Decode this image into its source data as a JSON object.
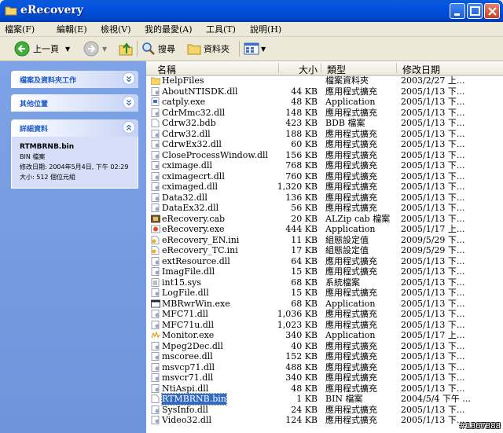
{
  "window": {
    "title": "eRecovery"
  },
  "menu": [
    "檔案(F)",
    "編輯(E)",
    "檢視(V)",
    "我的最愛(A)",
    "工具(T)",
    "說明(H)"
  ],
  "toolbar": {
    "back_label": "上一頁",
    "search_label": "搜尋",
    "folders_label": "資料夾"
  },
  "sidebar": {
    "panels": [
      {
        "title": "檔案及資料夾工作"
      },
      {
        "title": "其他位置"
      },
      {
        "title": "詳細資料"
      }
    ],
    "details": {
      "name": "RTMBRNB.bin",
      "type": "BIN 檔案",
      "modified": "修改日期: 2004年5月4日, 下午 02:29",
      "size": "大小: 512 個位元組"
    }
  },
  "columns": {
    "name": "名稱",
    "size": "大小",
    "type": "類型",
    "date": "修改日期"
  },
  "files": [
    {
      "name": "HelpFiles",
      "size": "",
      "type": "檔案資料夾",
      "date": "2003/2/27 上...",
      "icon": "folder-icon"
    },
    {
      "name": "AboutNTISDK.dll",
      "size": "44 KB",
      "type": "應用程式擴充",
      "date": "2005/1/13 下...",
      "icon": "dll-icon"
    },
    {
      "name": "catply.exe",
      "size": "48 KB",
      "type": "Application",
      "date": "2005/1/13 下...",
      "icon": "exe-icon"
    },
    {
      "name": "CdrMmc32.dll",
      "size": "148 KB",
      "type": "應用程式擴充",
      "date": "2005/1/13 下...",
      "icon": "dll-icon"
    },
    {
      "name": "Cdrw32.bdb",
      "size": "423 KB",
      "type": "BDB 檔案",
      "date": "2005/1/13 下...",
      "icon": "file-icon"
    },
    {
      "name": "Cdrw32.dll",
      "size": "188 KB",
      "type": "應用程式擴充",
      "date": "2005/1/13 下...",
      "icon": "dll-icon"
    },
    {
      "name": "CdrwEx32.dll",
      "size": "60 KB",
      "type": "應用程式擴充",
      "date": "2005/1/13 下...",
      "icon": "dll-icon"
    },
    {
      "name": "CloseProcessWindow.dll",
      "size": "156 KB",
      "type": "應用程式擴充",
      "date": "2005/1/13 下...",
      "icon": "dll-icon"
    },
    {
      "name": "cximage.dll",
      "size": "768 KB",
      "type": "應用程式擴充",
      "date": "2005/1/13 下...",
      "icon": "dll-icon"
    },
    {
      "name": "cximagecrt.dll",
      "size": "760 KB",
      "type": "應用程式擴充",
      "date": "2005/1/13 下...",
      "icon": "dll-icon"
    },
    {
      "name": "cximaged.dll",
      "size": "1,320 KB",
      "type": "應用程式擴充",
      "date": "2005/1/13 下...",
      "icon": "dll-icon"
    },
    {
      "name": "Data32.dll",
      "size": "136 KB",
      "type": "應用程式擴充",
      "date": "2005/1/13 下...",
      "icon": "dll-icon"
    },
    {
      "name": "DataEx32.dll",
      "size": "56 KB",
      "type": "應用程式擴充",
      "date": "2005/1/13 下...",
      "icon": "dll-icon"
    },
    {
      "name": "eRecovery.cab",
      "size": "20 KB",
      "type": "ALZip cab 檔案",
      "date": "2005/1/13 下...",
      "icon": "cab-icon"
    },
    {
      "name": "eRecovery.exe",
      "size": "444 KB",
      "type": "Application",
      "date": "2005/1/17 上...",
      "icon": "app-icon"
    },
    {
      "name": "eRecovery_EN.ini",
      "size": "11 KB",
      "type": "組態設定值",
      "date": "2009/5/29 下...",
      "icon": "ini-icon"
    },
    {
      "name": "eRecovery_TC.ini",
      "size": "17 KB",
      "type": "組態設定值",
      "date": "2009/5/29 下...",
      "icon": "ini-icon"
    },
    {
      "name": "extResource.dll",
      "size": "64 KB",
      "type": "應用程式擴充",
      "date": "2005/1/13 下...",
      "icon": "dll-icon"
    },
    {
      "name": "ImagFile.dll",
      "size": "15 KB",
      "type": "應用程式擴充",
      "date": "2005/1/13 下...",
      "icon": "dll-icon"
    },
    {
      "name": "int15.sys",
      "size": "68 KB",
      "type": "系統檔案",
      "date": "2005/1/13 下...",
      "icon": "sys-icon"
    },
    {
      "name": "LogFile.dll",
      "size": "15 KB",
      "type": "應用程式擴充",
      "date": "2005/1/13 下...",
      "icon": "dll-icon"
    },
    {
      "name": "MBRwrWin.exe",
      "size": "68 KB",
      "type": "Application",
      "date": "2005/1/13 下...",
      "icon": "window-icon"
    },
    {
      "name": "MFC71.dll",
      "size": "1,036 KB",
      "type": "應用程式擴充",
      "date": "2005/1/13 下...",
      "icon": "dll-icon"
    },
    {
      "name": "MFC71u.dll",
      "size": "1,023 KB",
      "type": "應用程式擴充",
      "date": "2005/1/13 下...",
      "icon": "dll-icon"
    },
    {
      "name": "Monitor.exe",
      "size": "340 KB",
      "type": "Application",
      "date": "2005/1/17 上...",
      "icon": "monitor-icon"
    },
    {
      "name": "Mpeg2Dec.dll",
      "size": "40 KB",
      "type": "應用程式擴充",
      "date": "2005/1/13 下...",
      "icon": "dll-icon"
    },
    {
      "name": "mscoree.dll",
      "size": "152 KB",
      "type": "應用程式擴充",
      "date": "2005/1/13 下...",
      "icon": "dll-icon"
    },
    {
      "name": "msvcp71.dll",
      "size": "488 KB",
      "type": "應用程式擴充",
      "date": "2005/1/13 下...",
      "icon": "dll-icon"
    },
    {
      "name": "msvcr71.dll",
      "size": "340 KB",
      "type": "應用程式擴充",
      "date": "2005/1/13 下...",
      "icon": "dll-icon"
    },
    {
      "name": "NtiAspi.dll",
      "size": "48 KB",
      "type": "應用程式擴充",
      "date": "2005/1/13 下...",
      "icon": "dll-icon"
    },
    {
      "name": "RTMBRNB.bin",
      "size": "1 KB",
      "type": "BIN 檔案",
      "date": "2004/5/4 下午 ...",
      "icon": "file-icon",
      "selected": true
    },
    {
      "name": "SysInfo.dll",
      "size": "24 KB",
      "type": "應用程式擴充",
      "date": "2005/1/13 下...",
      "icon": "dll-icon"
    },
    {
      "name": "Video32.dll",
      "size": "124 KB",
      "type": "應用程式擴充",
      "date": "2005/1/13 下...",
      "icon": "dll-icon"
    }
  ],
  "watermark": "#1367388"
}
